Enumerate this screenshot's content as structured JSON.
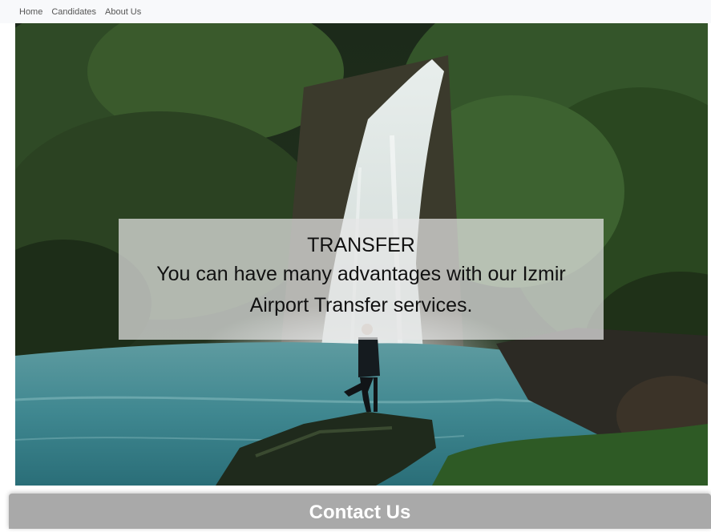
{
  "nav": {
    "items": [
      {
        "label": "Home"
      },
      {
        "label": "Candidates"
      },
      {
        "label": "About Us"
      }
    ]
  },
  "hero": {
    "image_icon": "waterfall-landscape-image",
    "caption_title": "TRANSFER",
    "caption_text": "You can have many advantages with our Izmir Airport Transfer services."
  },
  "contact": {
    "label": "Contact Us"
  },
  "colors": {
    "navbar_bg": "#f8f9fb",
    "caption_bg": "#e6e6e6",
    "contact_bg": "#a9a9a9"
  }
}
